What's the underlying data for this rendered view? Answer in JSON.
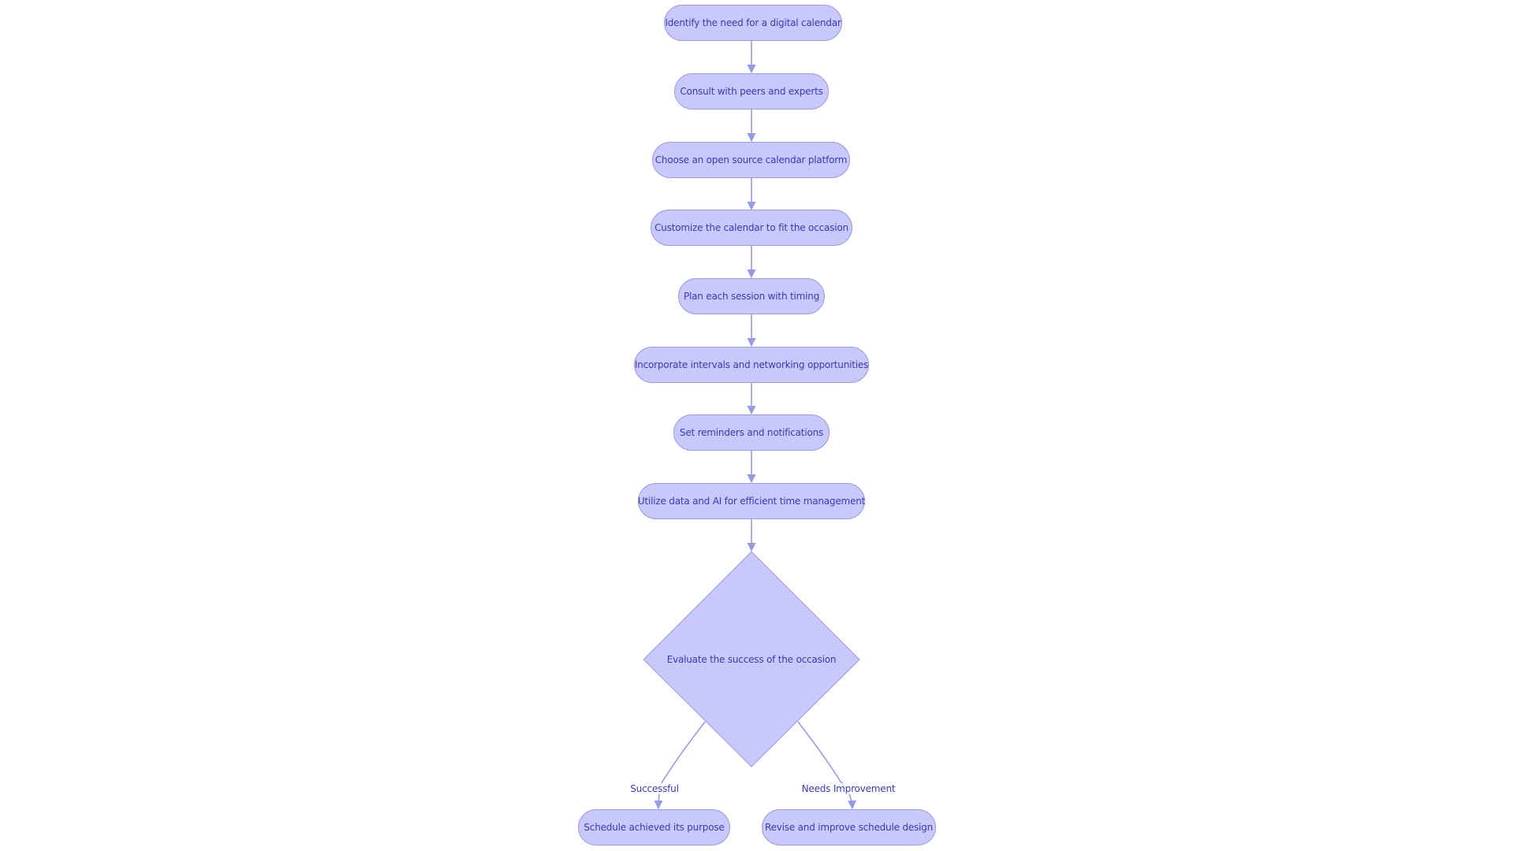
{
  "diagram": {
    "type": "flowchart",
    "nodes": [
      {
        "id": "n1",
        "label": "Identify the need for a digital calendar",
        "shape": "rounded"
      },
      {
        "id": "n2",
        "label": "Consult with peers and experts",
        "shape": "rounded"
      },
      {
        "id": "n3",
        "label": "Choose an open source calendar platform",
        "shape": "rounded"
      },
      {
        "id": "n4",
        "label": "Customize the calendar to fit the occasion",
        "shape": "rounded"
      },
      {
        "id": "n5",
        "label": "Plan each session with timing",
        "shape": "rounded"
      },
      {
        "id": "n6",
        "label": "Incorporate intervals and networking opportunities",
        "shape": "rounded"
      },
      {
        "id": "n7",
        "label": "Set reminders and notifications",
        "shape": "rounded"
      },
      {
        "id": "n8",
        "label": "Utilize data and AI for efficient time management",
        "shape": "rounded"
      },
      {
        "id": "n9",
        "label": "Evaluate the success of the occasion",
        "shape": "diamond"
      },
      {
        "id": "n10",
        "label": "Schedule achieved its purpose",
        "shape": "rounded"
      },
      {
        "id": "n11",
        "label": "Revise and improve schedule design",
        "shape": "rounded"
      }
    ],
    "edges": [
      {
        "from": "n1",
        "to": "n2",
        "label": ""
      },
      {
        "from": "n2",
        "to": "n3",
        "label": ""
      },
      {
        "from": "n3",
        "to": "n4",
        "label": ""
      },
      {
        "from": "n4",
        "to": "n5",
        "label": ""
      },
      {
        "from": "n5",
        "to": "n6",
        "label": ""
      },
      {
        "from": "n6",
        "to": "n7",
        "label": ""
      },
      {
        "from": "n7",
        "to": "n8",
        "label": ""
      },
      {
        "from": "n8",
        "to": "n9",
        "label": ""
      },
      {
        "from": "n9",
        "to": "n10",
        "label": "Successful"
      },
      {
        "from": "n9",
        "to": "n11",
        "label": "Needs Improvement"
      }
    ],
    "colors": {
      "node_fill": "#c8c8fa",
      "node_stroke": "#9c9cdc",
      "text": "#3a3ab0",
      "edge": "#9a9ae4"
    }
  }
}
